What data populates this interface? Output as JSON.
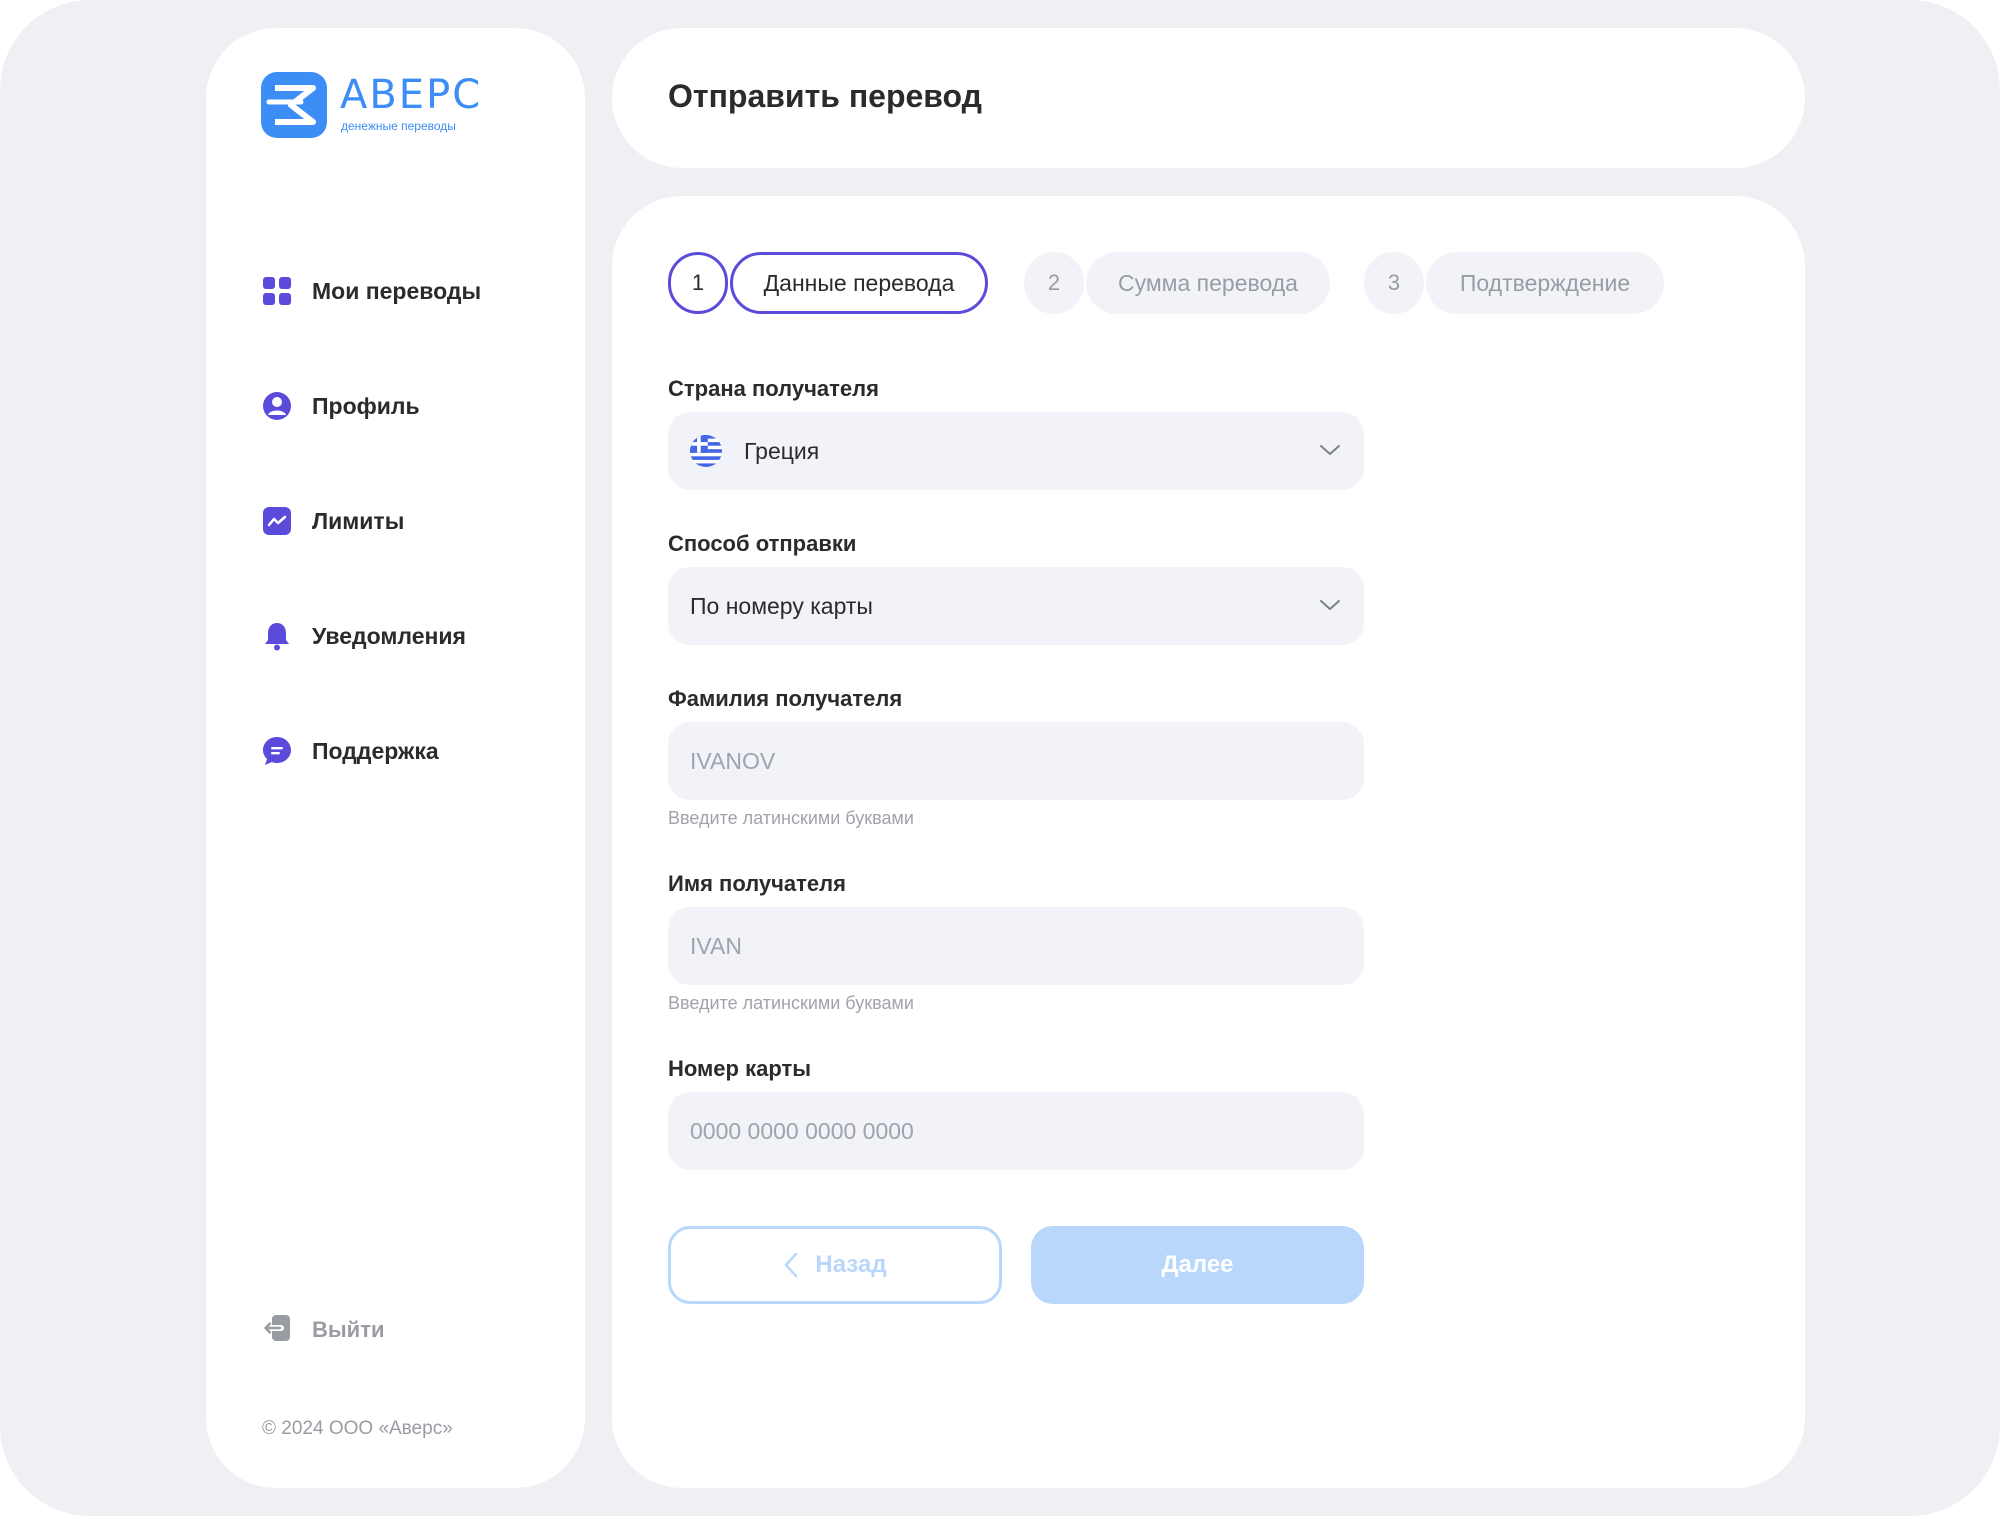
{
  "brand": {
    "name": "АВЕРС",
    "tagline": "денежные переводы"
  },
  "nav": {
    "items": [
      {
        "label": "Мои переводы",
        "icon": "grid-icon"
      },
      {
        "label": "Профиль",
        "icon": "user-icon"
      },
      {
        "label": "Лимиты",
        "icon": "chart-icon"
      },
      {
        "label": "Уведомления",
        "icon": "bell-icon"
      },
      {
        "label": "Поддержка",
        "icon": "chat-icon"
      }
    ],
    "logout_label": "Выйти"
  },
  "footer": {
    "copyright": "© 2024 ООО «Аверс»"
  },
  "header": {
    "title": "Отправить перевод"
  },
  "steps": [
    {
      "number": "1",
      "label": "Данные перевода",
      "active": true
    },
    {
      "number": "2",
      "label": "Сумма перевода",
      "active": false
    },
    {
      "number": "3",
      "label": "Подтверждение",
      "active": false
    }
  ],
  "form": {
    "country": {
      "label": "Страна получателя",
      "value": "Греция",
      "flag": "greece-flag-icon"
    },
    "method": {
      "label": "Способ отправки",
      "value": "По номеру карты"
    },
    "last_name": {
      "label": "Фамилия получателя",
      "placeholder": "IVANOV",
      "hint": "Введите латинскими буквами"
    },
    "first_name": {
      "label": "Имя получателя",
      "placeholder": "IVAN",
      "hint": "Введите латинскими буквами"
    },
    "card": {
      "label": "Номер карты",
      "placeholder": "0000 0000 0000 0000"
    }
  },
  "buttons": {
    "back": "Назад",
    "next": "Далее"
  },
  "colors": {
    "accent": "#5b4bdb",
    "brand_blue": "#3c8df5",
    "button_disabled": "#b9d7fb",
    "field_bg": "#f2f3f8",
    "page_bg": "#f0f0f4"
  }
}
